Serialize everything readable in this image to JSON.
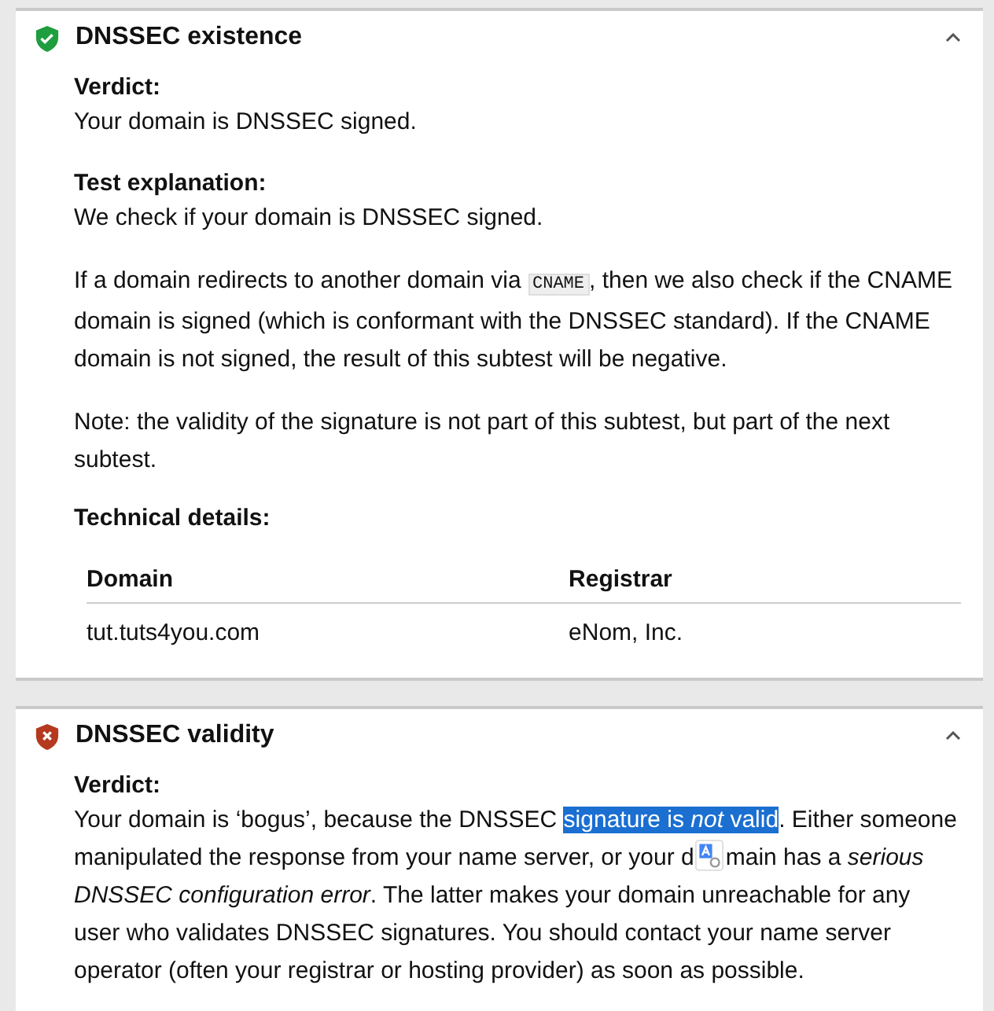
{
  "sections": [
    {
      "title": "DNSSEC existence",
      "passed": true,
      "expanded": true,
      "blocks": [
        {
          "kind": "labeled",
          "label": "Verdict:",
          "parts": [
            {
              "kind": "text",
              "text": "Your domain is DNSSEC signed."
            }
          ]
        },
        {
          "kind": "labeled",
          "label": "Test explanation:",
          "parts": [
            {
              "kind": "text",
              "text": "We check if your domain is DNSSEC signed."
            }
          ]
        },
        {
          "kind": "para",
          "parts": [
            {
              "kind": "text",
              "text": "If a domain redirects to another domain via "
            },
            {
              "kind": "code",
              "text": "CNAME"
            },
            {
              "kind": "text",
              "text": ", then we also check if the CNAME domain is signed (which is conformant with the DNSSEC standard). If the CNAME domain is not signed, the result of this subtest will be negative."
            }
          ]
        },
        {
          "kind": "para",
          "parts": [
            {
              "kind": "text",
              "text": "Note: the validity of the signature is not part of this subtest, but part of the next subtest."
            }
          ]
        },
        {
          "kind": "heading",
          "text": "Technical details:"
        },
        {
          "kind": "table",
          "columns": [
            "Domain",
            "Registrar"
          ],
          "rows": [
            [
              "tut.tuts4you.com",
              "eNom, Inc."
            ]
          ]
        }
      ]
    },
    {
      "title": "DNSSEC validity",
      "passed": false,
      "expanded": true,
      "blocks": [
        {
          "kind": "labeled",
          "label": "Verdict:",
          "parts": [
            {
              "kind": "text",
              "text": "Your domain is ‘bogus’, because the DNSSEC "
            },
            {
              "kind": "mark",
              "text": "signature is *not* valid"
            },
            {
              "kind": "text",
              "text": ". Either someone manipulated the response from your name server, or your d"
            },
            {
              "kind": "translate_badge"
            },
            {
              "kind": "text",
              "text": "main has a *serious DNSSEC configuration error*. The latter makes your domain unreachable for any user who validates DNSSEC signatures. You should contact your name server operator (often your registrar or hosting provider) as soon as possible."
            }
          ]
        }
      ]
    }
  ]
}
